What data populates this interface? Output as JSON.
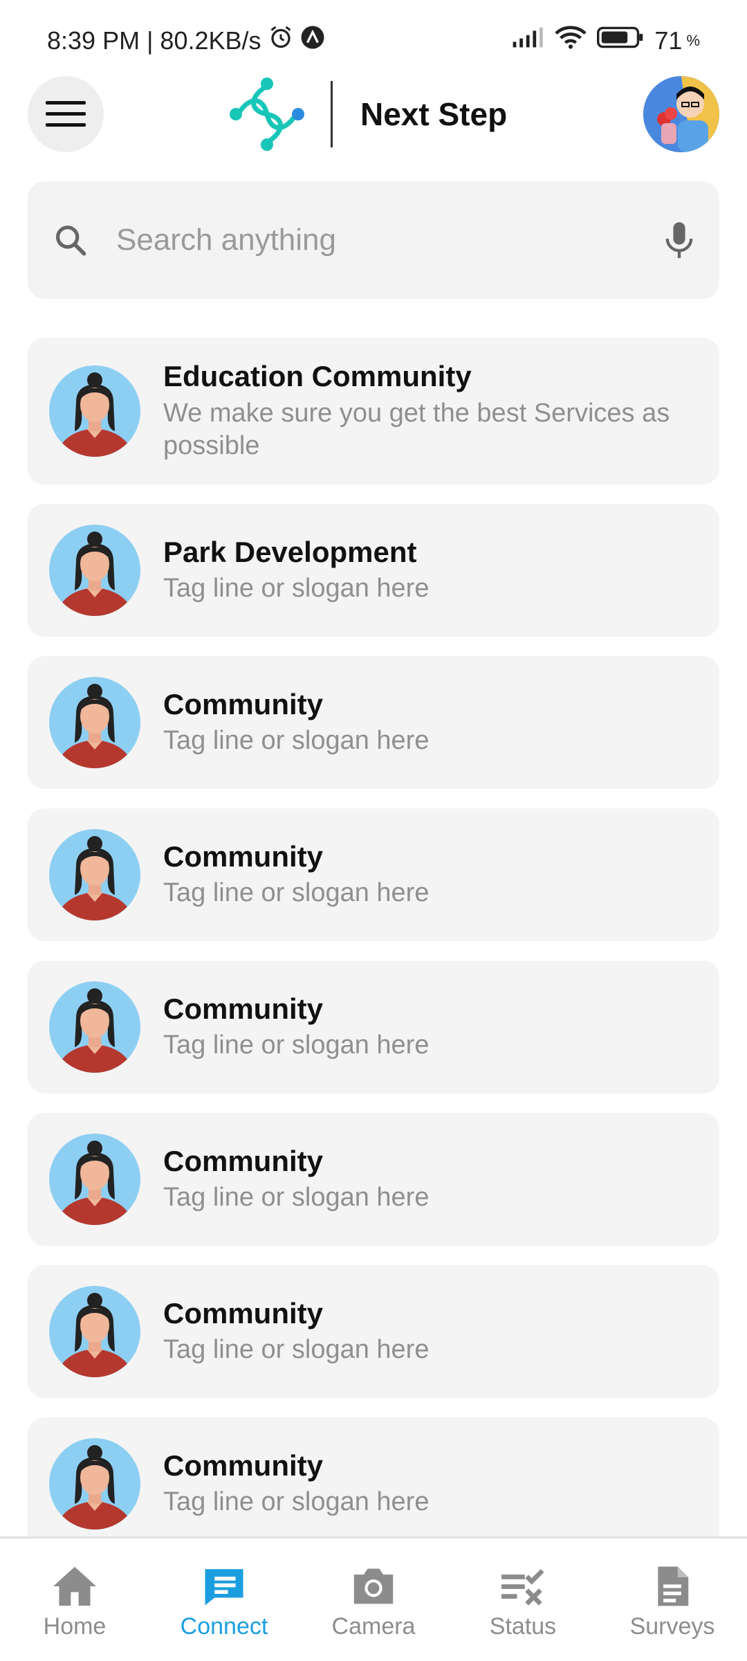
{
  "status_bar": {
    "time_speed": "8:39 PM | 80.2KB/s",
    "battery": "71",
    "battery_unit": "%"
  },
  "app_bar": {
    "brand": "Next Step"
  },
  "search": {
    "placeholder": "Search anything"
  },
  "communities": [
    {
      "title": "Education Community",
      "tagline": "We make sure you get the best Services as possible"
    },
    {
      "title": "Park Development",
      "tagline": "Tag line or slogan here"
    },
    {
      "title": "Community",
      "tagline": "Tag line or slogan here"
    },
    {
      "title": "Community",
      "tagline": "Tag line or slogan here"
    },
    {
      "title": "Community",
      "tagline": "Tag line or slogan here"
    },
    {
      "title": "Community",
      "tagline": "Tag line or slogan here"
    },
    {
      "title": "Community",
      "tagline": "Tag line or slogan here"
    },
    {
      "title": "Community",
      "tagline": "Tag line or slogan here"
    }
  ],
  "bottom_nav": [
    {
      "label": "Home",
      "icon": "home-icon",
      "active": false
    },
    {
      "label": "Connect",
      "icon": "chat-icon",
      "active": true
    },
    {
      "label": "Camera",
      "icon": "camera-icon",
      "active": false
    },
    {
      "label": "Status",
      "icon": "status-icon",
      "active": false
    },
    {
      "label": "Surveys",
      "icon": "document-icon",
      "active": false
    }
  ],
  "colors": {
    "accent": "#1b9ee0",
    "logo": "#18c6b8",
    "card_bg": "#f4f4f4"
  }
}
